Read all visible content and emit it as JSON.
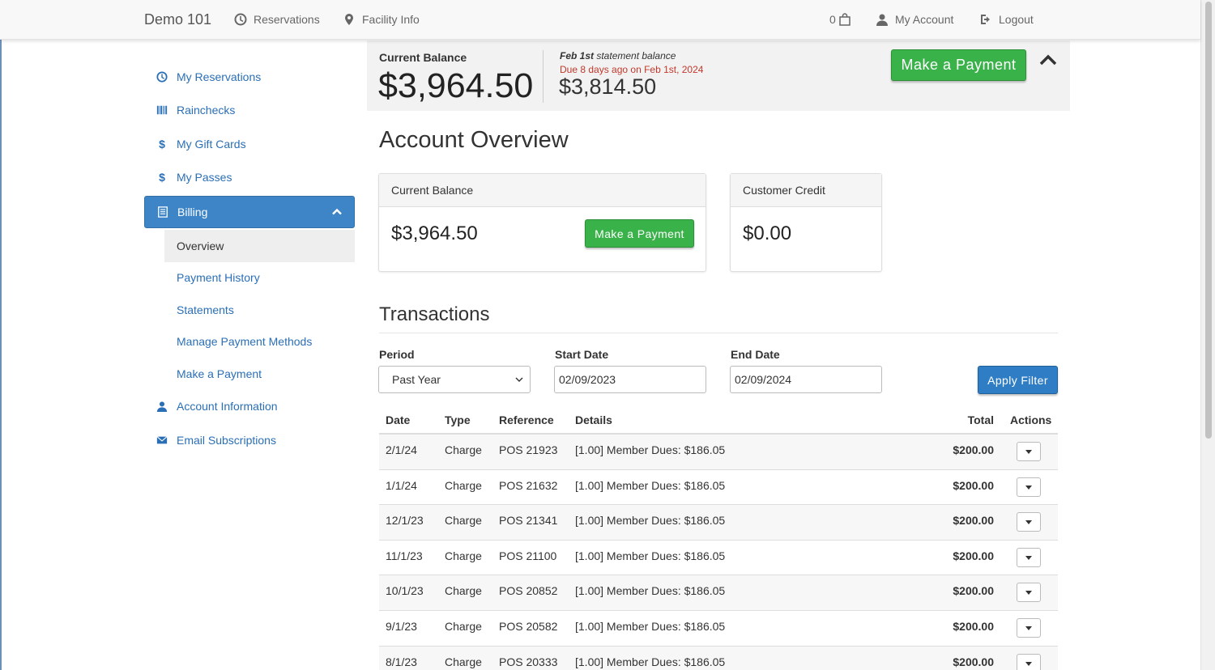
{
  "nav": {
    "brand": "Demo 101",
    "reservations": "Reservations",
    "facility_info": "Facility Info",
    "cart_count": "0",
    "my_account": "My Account",
    "logout": "Logout"
  },
  "sidebar": {
    "items": [
      {
        "label": "My Reservations",
        "icon": "clock-icon"
      },
      {
        "label": "Rainchecks",
        "icon": "barcode-icon"
      },
      {
        "label": "My Gift Cards",
        "icon": "dollar-icon"
      },
      {
        "label": "My Passes",
        "icon": "dollar-icon"
      },
      {
        "label": "Billing",
        "icon": "list-icon"
      }
    ],
    "billing_sub": [
      "Overview",
      "Payment History",
      "Statements",
      "Manage Payment Methods",
      "Make a Payment"
    ],
    "after": [
      {
        "label": "Account Information",
        "icon": "user-icon"
      },
      {
        "label": "Email Subscriptions",
        "icon": "envelope-icon"
      }
    ]
  },
  "balance_bar": {
    "current_label": "Current Balance",
    "current_amount": "$3,964.50",
    "statement_date": "Feb 1st",
    "statement_suffix": " statement balance",
    "due_text": "Due 8 days ago on Feb 1st, 2024",
    "statement_amount": "$3,814.50",
    "pay_button": "Make a Payment"
  },
  "overview": {
    "title": "Account Overview",
    "current_balance_title": "Current Balance",
    "current_balance_amount": "$3,964.50",
    "pay_button": "Make a Payment",
    "credit_title": "Customer Credit",
    "credit_amount": "$0.00"
  },
  "transactions": {
    "title": "Transactions",
    "filter": {
      "period_label": "Period",
      "period_value": "Past Year",
      "start_label": "Start Date",
      "start_value": "02/09/2023",
      "end_label": "End Date",
      "end_value": "02/09/2024",
      "apply": "Apply Filter"
    },
    "columns": [
      "Date",
      "Type",
      "Reference",
      "Details",
      "Total",
      "Actions"
    ],
    "rows": [
      {
        "date": "2/1/24",
        "type": "Charge",
        "ref": "POS 21923",
        "details": "[1.00] Member Dues: $186.05",
        "total": "$200.00"
      },
      {
        "date": "1/1/24",
        "type": "Charge",
        "ref": "POS 21632",
        "details": "[1.00] Member Dues: $186.05",
        "total": "$200.00"
      },
      {
        "date": "12/1/23",
        "type": "Charge",
        "ref": "POS 21341",
        "details": "[1.00] Member Dues: $186.05",
        "total": "$200.00"
      },
      {
        "date": "11/1/23",
        "type": "Charge",
        "ref": "POS 21100",
        "details": "[1.00] Member Dues: $186.05",
        "total": "$200.00"
      },
      {
        "date": "10/1/23",
        "type": "Charge",
        "ref": "POS 20852",
        "details": "[1.00] Member Dues: $186.05",
        "total": "$200.00"
      },
      {
        "date": "9/1/23",
        "type": "Charge",
        "ref": "POS 20582",
        "details": "[1.00] Member Dues: $186.05",
        "total": "$200.00"
      },
      {
        "date": "8/1/23",
        "type": "Charge",
        "ref": "POS 20333",
        "details": "[1.00] Member Dues: $186.05",
        "total": "$200.00"
      }
    ]
  },
  "colors": {
    "link": "#2a6fb6",
    "active": "#3d85c6",
    "success": "#3ab24a",
    "primary": "#2f7ec5",
    "due": "#c0392b"
  }
}
